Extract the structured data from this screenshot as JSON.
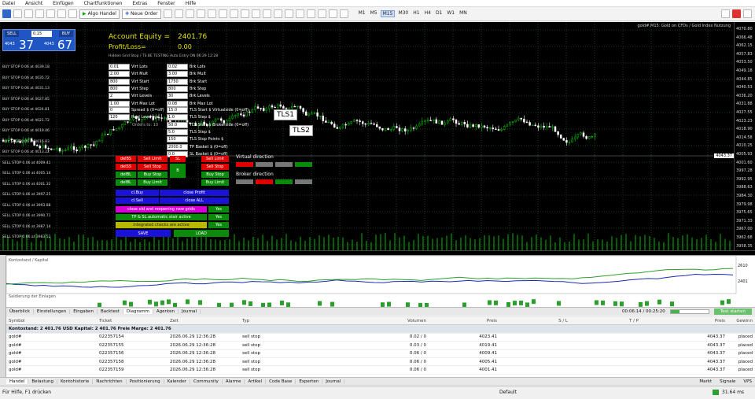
{
  "menu": [
    "Datei",
    "Ansicht",
    "Einfügen",
    "Chartfunktionen",
    "Extras",
    "Fenster",
    "Hilfe"
  ],
  "toolbar": {
    "algo": "Algo Handel",
    "new_order": "Neue Order",
    "timeframes": [
      "M1",
      "M5",
      "M15",
      "M30",
      "H1",
      "H4",
      "D1",
      "W1",
      "MN"
    ],
    "active_tf": "M15"
  },
  "chart_title": "gold#,M15: Gold on CFDs / Gold Index Nutzung",
  "trade_panel": {
    "sell": "SELL",
    "buy": "BUY",
    "lot": "0.15",
    "sell_small": "4043",
    "sell_big": "37",
    "buy_small": "4043",
    "buy_big": "67"
  },
  "ea": {
    "equity_label": "Account Equity =",
    "equity_value": "2401.76",
    "pl_label": "Profit/Loss=",
    "pl_value": "0.00",
    "hidden_label": "Hidden Grid Stop / TS BE TESTING Auto Entry ON 06:29 12:28",
    "virt": [
      [
        "0.01",
        "Virt Lots"
      ],
      [
        "2.00",
        "Virt Mult"
      ],
      [
        "800",
        "Virt Start"
      ],
      [
        "800",
        "Virt Step"
      ],
      [
        "2",
        "Virt Levels"
      ],
      [
        "1.00",
        "Virt Max Lot"
      ]
    ],
    "brk": [
      [
        "0.02",
        "Brk Lots"
      ],
      [
        "3.00",
        "Brk Mult"
      ],
      [
        "1750",
        "Brk Start"
      ],
      [
        "800",
        "Brk Step"
      ],
      [
        "30",
        "Brk Levels"
      ],
      [
        "0.08",
        "Brk Max Lot"
      ]
    ],
    "spread": [
      [
        "0",
        "Spread $ (0=off)"
      ],
      [
        "120",
        "Real Leverage"
      ]
    ],
    "spread_note": "Orders to: 10",
    "tls": [
      [
        "15.0",
        "TLS Start $ Virtualside (0=off)"
      ],
      [
        "1.0",
        "TLS Step $"
      ],
      [
        "50.0",
        "TLS Start $ Brokerside (0=off)"
      ],
      [
        "5.0",
        "TLS Step $"
      ],
      [
        "150",
        "TLS Stop Points $"
      ],
      [
        "2000.0",
        "TP Basket $ (0=off)"
      ],
      [
        "0.0",
        "SL Basket $ (0=off)"
      ]
    ],
    "tls1": "TLS1",
    "tls2": "TLS2",
    "btn_rows": [
      [
        "delBS",
        "Sell Limit",
        "SL",
        "Sell Limit"
      ],
      [
        "delSS",
        "Sell Stop",
        "B",
        "Sell Stop"
      ],
      [
        "delBL",
        "Buy Stop",
        "",
        "Buy Stop"
      ],
      [
        "delBL",
        "Buy Limit",
        "",
        "Buy Limit"
      ]
    ],
    "cl_buy": "cl.Buy",
    "close_profit": "close Profit",
    "cl_sell": "cl.Sell",
    "close_all": "close ALL",
    "close_old": "close old and reopening new grids",
    "yes": "Yes",
    "tp_sl": "TP & SL automatic stair active",
    "integrated": "integrated checks are active",
    "save": "SAVE",
    "load": "LOAD",
    "virtual_dir": "Virtual direction",
    "broker_dir": "Broker direction",
    "left_orders": [
      "BUY STOP 0.06 at 4039.18",
      "BUY STOP 0.06 at 4035.72",
      "BUY STOP 0.06 at 4031.13",
      "BUY STOP 0.06 at 4027.85",
      "BUY STOP 0.06 at 4024.81",
      "BUY STOP 0.06 at 4021.72",
      "BUY STOP 0.06 at 4019.46",
      "BUY STOP 0.06 at 4016.83",
      "BUY STOP 0.06 at 4013.22",
      "SELL STOP 0.06 at 4009.41",
      "SELL STOP 0.06 at 4005.14",
      "SELL STOP 0.06 at 4001.32",
      "SELL STOP 0.06 at 3997.25",
      "SELL STOP 0.06 at 3993.88",
      "SELL STOP 0.06 at 3990.71",
      "SELL STOP 0.06 at 3987.14",
      "SELL STOP 0.06 at 3983.52"
    ]
  },
  "price_scale": [
    "4070.80",
    "4066.48",
    "4062.15",
    "4057.83",
    "4053.50",
    "4049.18",
    "4044.85",
    "4040.53",
    "4036.20",
    "4031.88",
    "4027.55",
    "4023.23",
    "4018.90",
    "4014.58",
    "4010.25",
    "4005.93",
    "4001.60",
    "3997.28",
    "3992.95",
    "3988.63",
    "3984.30",
    "3979.98",
    "3975.65",
    "3971.33",
    "3967.00",
    "3962.68",
    "3958.35"
  ],
  "bid_tag": "4043.37",
  "sub": {
    "title": "Kontostand / Kapital",
    "saldo": "Saldierung der Einlagen",
    "right1": "2610",
    "right2": "2401"
  },
  "tabs": [
    "Überblick",
    "Einstellungen",
    "Eingaben",
    "Backtest",
    "Diagramm",
    "Agenten",
    "Journal"
  ],
  "active_tab": "Diagramm",
  "progress": "00:06:14 / 00:25:20",
  "start": "Test starten",
  "table": {
    "headers": [
      "Symbol",
      "Ticket",
      "Zeit",
      "Typ",
      "Volumen",
      "Preis",
      "S / L",
      "T / P",
      "Preis",
      "Gewinn"
    ],
    "summary": "Kontostand: 2 401.76 USD  Kapital: 2 401.76  Freie Marge: 2 401.76",
    "rows": [
      [
        "gold#",
        "022357154",
        "2026.06.29 12:36:28",
        "sell stop",
        "0.02 / 0",
        "4023.41",
        "",
        "",
        "4043.37",
        "placed"
      ],
      [
        "gold#",
        "022357155",
        "2026.06.29 12:36:28",
        "sell stop",
        "0.03 / 0",
        "4019.41",
        "",
        "",
        "4043.37",
        "placed"
      ],
      [
        "gold#",
        "022357156",
        "2026.06.29 12:36:28",
        "sell stop",
        "0.06 / 0",
        "4009.41",
        "",
        "",
        "4043.37",
        "placed"
      ],
      [
        "gold#",
        "022357158",
        "2026.06.29 12:36:28",
        "sell stop",
        "0.06 / 0",
        "4005.41",
        "",
        "",
        "4043.37",
        "placed"
      ],
      [
        "gold#",
        "022357159",
        "2026.06.29 12:36:28",
        "sell stop",
        "0.06 / 0",
        "4001.41",
        "",
        "",
        "4043.37",
        "placed"
      ]
    ]
  },
  "bottom_tabs": [
    "Handel",
    "Belastung",
    "Kontohistorie",
    "Nachrichten",
    "Positionierung",
    "Kalender",
    "Community",
    "Alarme",
    "Artikel",
    "Code Base",
    "Experten",
    "Journal"
  ],
  "status": {
    "help": "Für Hilfe, F1 drücken",
    "profile": "Default",
    "market": "Markt",
    "signals": "Signale",
    "vps": "VPS",
    "ping": "31.64 ms"
  },
  "colors": {
    "bull": "#00c800",
    "bear": "#ffffff",
    "grid": "#1e3b1e"
  }
}
